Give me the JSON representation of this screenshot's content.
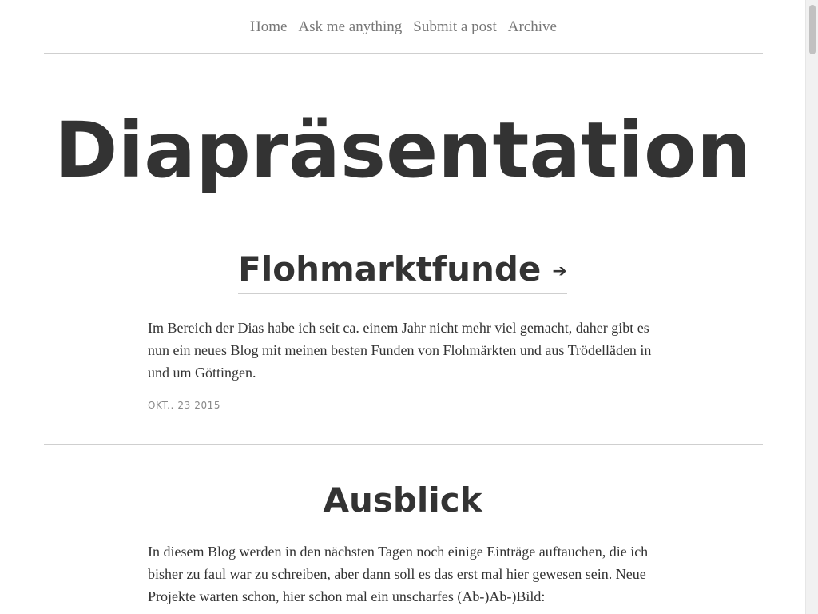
{
  "nav": {
    "items": [
      {
        "label": "Home"
      },
      {
        "label": "Ask me anything"
      },
      {
        "label": "Submit a post"
      },
      {
        "label": "Archive"
      }
    ]
  },
  "blog": {
    "title": "Diapräsentation"
  },
  "posts": [
    {
      "title": "Flohmarktfunde",
      "link_icon": "arrow-right-icon",
      "arrow_glyph": "➔",
      "body": "Im Bereich der Dias habe ich seit ca. einem Jahr nicht mehr viel gemacht, daher gibt es nun ein neues Blog mit meinen besten Funden von Flohmärkten und aus Trödelläden in und um Göttingen.",
      "date": "OKT.. 23 2015"
    },
    {
      "title": "Ausblick",
      "body": "In diesem Blog werden in den nächsten Tagen noch einige Einträge auftauchen, die ich bisher zu faul war zu schreiben, aber dann soll es das erst mal hier gewesen sein. Neue Projekte warten schon, hier schon mal ein unscharfes (Ab-)Ab-)Bild:"
    }
  ],
  "colors": {
    "text": "#333333",
    "nav_text": "#777777",
    "date_text": "#888888",
    "divider": "#cfcfcf"
  }
}
